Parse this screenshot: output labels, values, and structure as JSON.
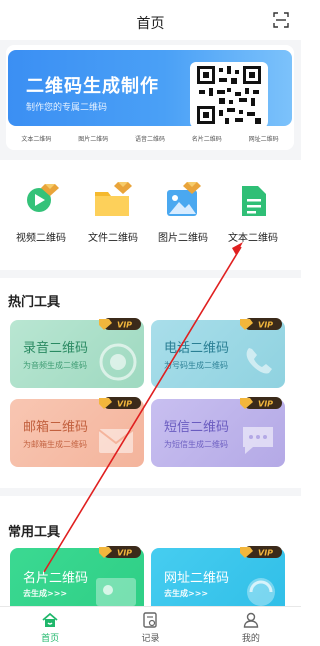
{
  "header": {
    "title": "首页"
  },
  "banner": {
    "title": "二维码生成制作",
    "subtitle": "制作您的专属二维码"
  },
  "quick_links": [
    "文本二维码",
    "图片二维码",
    "语音二维码",
    "名片二维码",
    "网址二维码"
  ],
  "tools": [
    {
      "label": "视频二维码",
      "icon": "video-icon"
    },
    {
      "label": "文件二维码",
      "icon": "folder-icon"
    },
    {
      "label": "图片二维码",
      "icon": "image-icon"
    },
    {
      "label": "文本二维码",
      "icon": "document-icon"
    }
  ],
  "hot_tools": {
    "title": "热门工具",
    "cards": [
      {
        "title": "录音二维码",
        "subtitle": "为音频生成二维码",
        "color": "#9ed9c0"
      },
      {
        "title": "电话二维码",
        "subtitle": "为号码生成二维码",
        "color": "#8fd2e0"
      },
      {
        "title": "邮箱二维码",
        "subtitle": "为邮箱生成二维码",
        "color": "#f4b49c"
      },
      {
        "title": "短信二维码",
        "subtitle": "为短信生成二维码",
        "color": "#b4a9e6"
      }
    ]
  },
  "common_tools": {
    "title": "常用工具",
    "cards": [
      {
        "title": "名片二维码",
        "subtitle": "去生成>>>",
        "color": "#2fcf86"
      },
      {
        "title": "网址二维码",
        "subtitle": "去生成>>>",
        "color": "#31bfe8"
      }
    ]
  },
  "vip_badge": "VIP",
  "tabbar": {
    "items": [
      {
        "label": "首页",
        "active": true
      },
      {
        "label": "记录",
        "active": false
      },
      {
        "label": "我的",
        "active": false
      }
    ]
  },
  "accent_color": "#1fb76b"
}
